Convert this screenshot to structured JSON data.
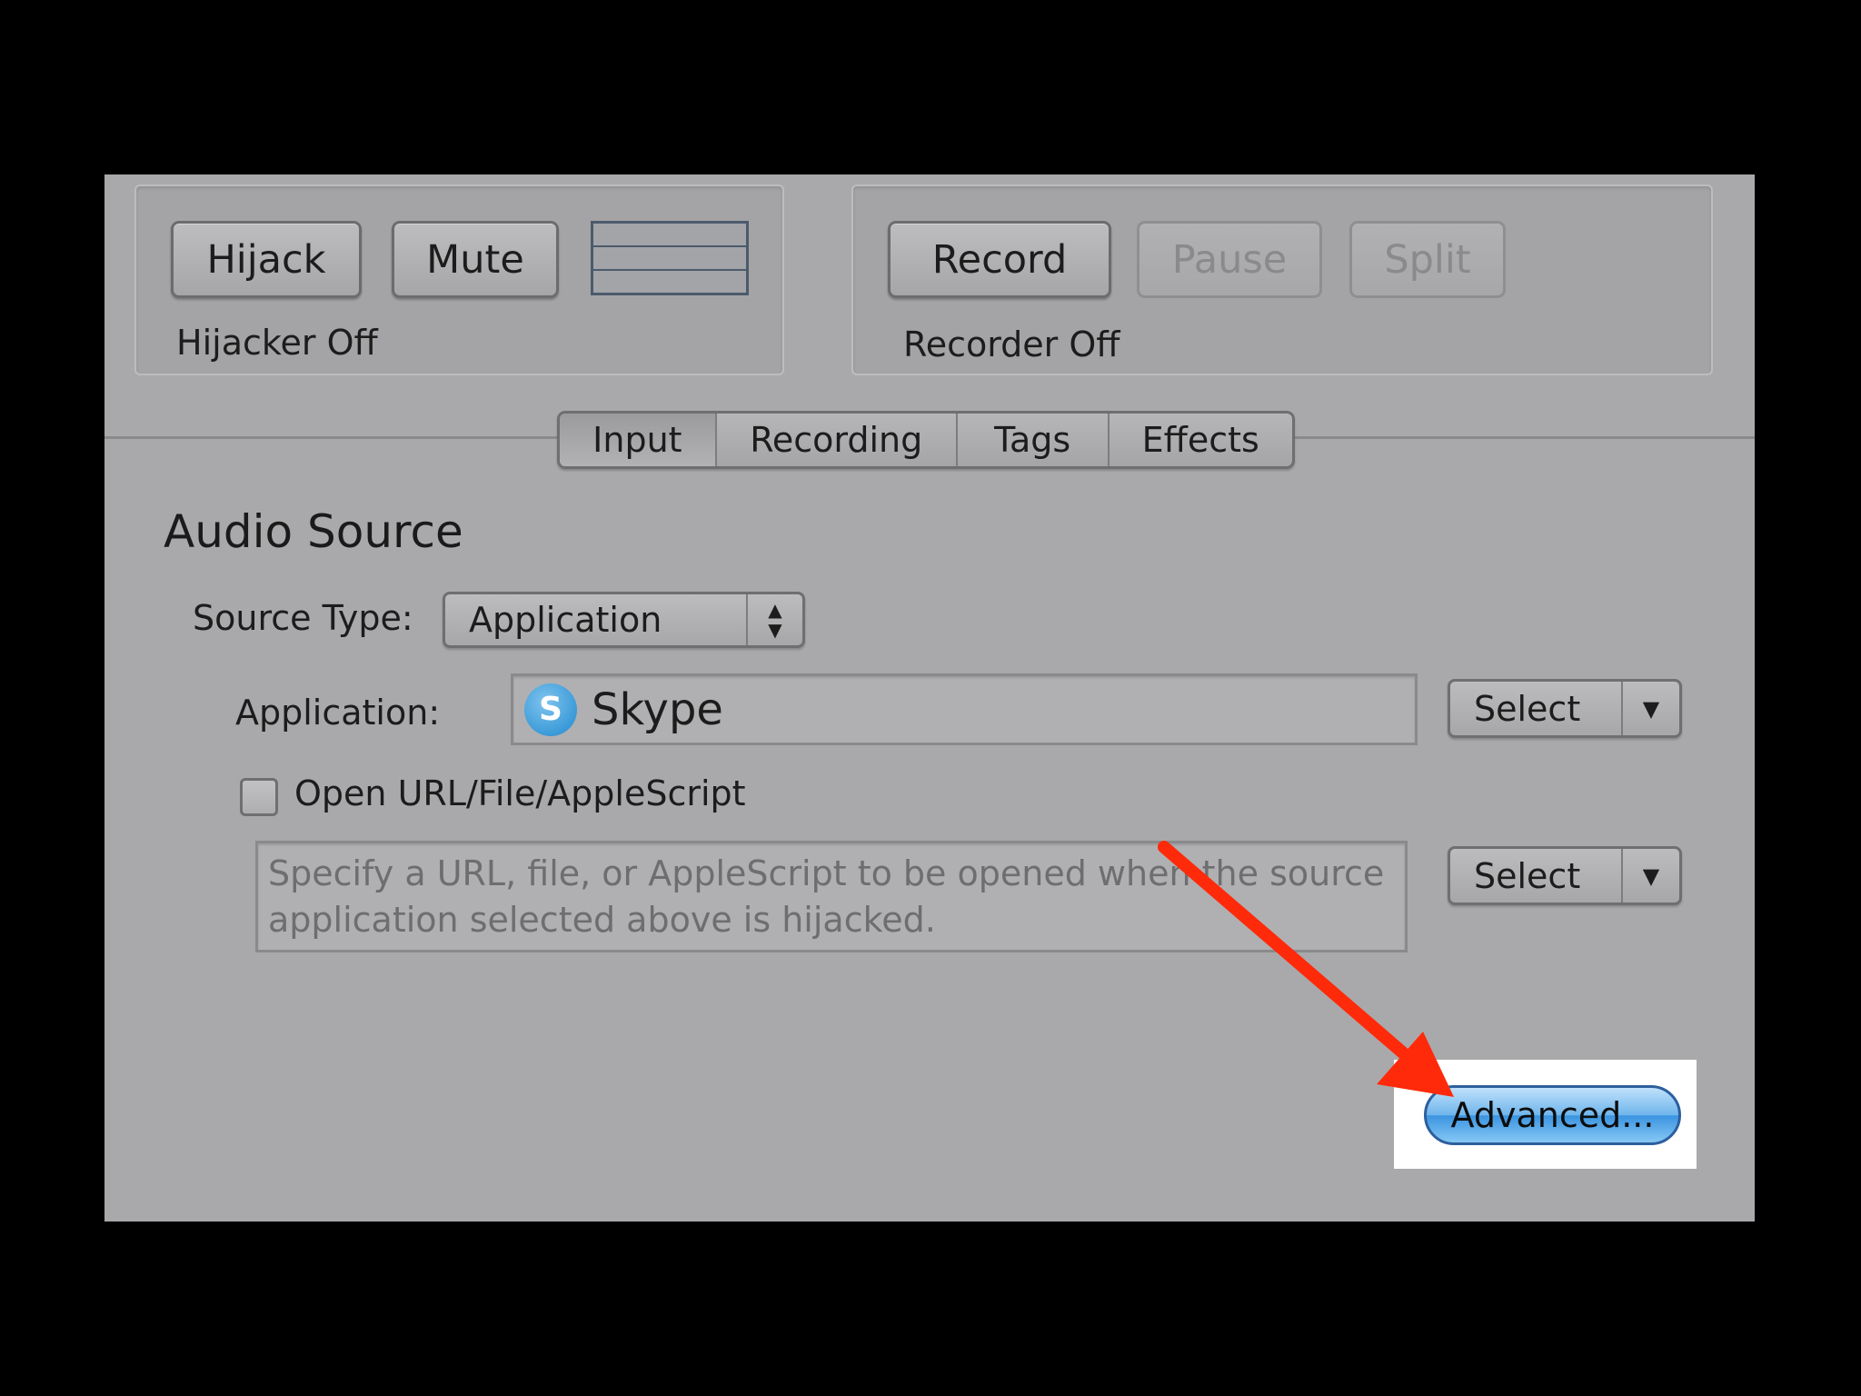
{
  "hijacker": {
    "hijack_label": "Hijack",
    "mute_label": "Mute",
    "status": "Hijacker Off"
  },
  "recorder": {
    "record_label": "Record",
    "pause_label": "Pause",
    "split_label": "Split",
    "status": "Recorder Off"
  },
  "tabs": [
    {
      "label": "Input",
      "selected": true
    },
    {
      "label": "Recording",
      "selected": false
    },
    {
      "label": "Tags",
      "selected": false
    },
    {
      "label": "Effects",
      "selected": false
    }
  ],
  "audio_source": {
    "heading": "Audio Source",
    "source_type_label": "Source Type:",
    "source_type_value": "Application",
    "application_label": "Application:",
    "application_value": "Skype",
    "application_icon": "skype-icon",
    "select_label": "Select",
    "open_url_label": "Open URL/File/AppleScript",
    "open_url_checked": false,
    "url_placeholder": "Specify a URL, file, or AppleScript to be opened when the source application selected above is hijacked.",
    "url_select_label": "Select",
    "advanced_label": "Advanced..."
  },
  "annotation": {
    "arrow_color": "#ff2a0a",
    "highlight_color": "#ffffff"
  }
}
